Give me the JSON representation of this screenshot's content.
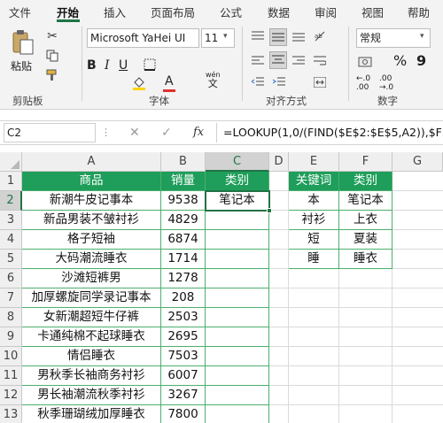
{
  "tabs": [
    "文件",
    "开始",
    "插入",
    "页面布局",
    "公式",
    "数据",
    "审阅",
    "视图",
    "帮助"
  ],
  "clipboard": {
    "paste_label": "粘贴",
    "group_label": "剪贴板"
  },
  "font": {
    "name": "Microsoft YaHei UI",
    "size": "11",
    "group_label": "字体",
    "pinyin": "wén"
  },
  "alignment": {
    "group_label": "对齐方式"
  },
  "number": {
    "format": "常规",
    "group_label": "数字"
  },
  "formula_bar": {
    "name_box": "C2",
    "cancel": "✕",
    "enter": "✓",
    "fx": "fx",
    "formula": "=LOOKUP(1,0/(FIND($E$2:$E$5,A2)),$F$"
  },
  "columns": [
    "A",
    "B",
    "C",
    "D",
    "E",
    "F",
    "G"
  ],
  "rows": [
    "1",
    "2",
    "3",
    "4",
    "5",
    "6",
    "7",
    "8",
    "9",
    "10",
    "11",
    "12",
    "13"
  ],
  "table": {
    "headers": [
      "商品",
      "销量",
      "类别"
    ],
    "rows": [
      {
        "product": "新潮牛皮记事本",
        "sales": "9538",
        "category": "笔记本"
      },
      {
        "product": "新品男装不皱衬衫",
        "sales": "4829",
        "category": ""
      },
      {
        "product": "格子短袖",
        "sales": "6874",
        "category": ""
      },
      {
        "product": "大码潮流睡衣",
        "sales": "1714",
        "category": ""
      },
      {
        "product": "沙滩短裤男",
        "sales": "1278",
        "category": ""
      },
      {
        "product": "加厚螺旋同学录记事本",
        "sales": "208",
        "category": ""
      },
      {
        "product": "女新潮超短牛仔裤",
        "sales": "2503",
        "category": ""
      },
      {
        "product": "卡通纯棉不起球睡衣",
        "sales": "2695",
        "category": ""
      },
      {
        "product": "情侣睡衣",
        "sales": "7503",
        "category": ""
      },
      {
        "product": "男秋季长袖商务衬衫",
        "sales": "6007",
        "category": ""
      },
      {
        "product": "男长袖潮流秋季衬衫",
        "sales": "3267",
        "category": ""
      },
      {
        "product": "秋季珊瑚绒加厚睡衣",
        "sales": "7800",
        "category": ""
      }
    ]
  },
  "lookup": {
    "headers": [
      "关键词",
      "类别"
    ],
    "rows": [
      [
        "本",
        "笔记本"
      ],
      [
        "衬衫",
        "上衣"
      ],
      [
        "短",
        "夏装"
      ],
      [
        "睡",
        "睡衣"
      ]
    ]
  },
  "colors": {
    "accent": "#217346",
    "header_fill": "#1e9e5a",
    "border": "#4caf6e"
  }
}
